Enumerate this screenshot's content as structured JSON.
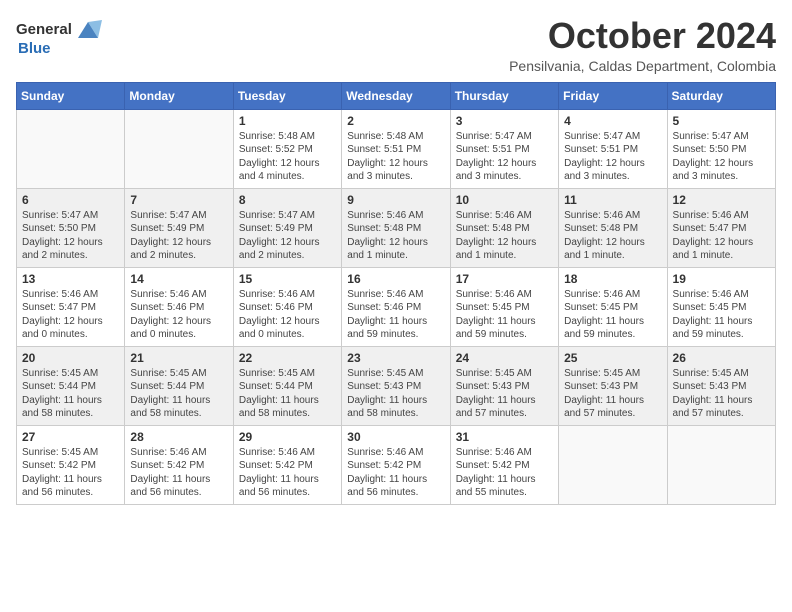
{
  "header": {
    "logo_line1": "General",
    "logo_line2": "Blue",
    "month": "October 2024",
    "location": "Pensilvania, Caldas Department, Colombia"
  },
  "days_of_week": [
    "Sunday",
    "Monday",
    "Tuesday",
    "Wednesday",
    "Thursday",
    "Friday",
    "Saturday"
  ],
  "weeks": [
    [
      {
        "day": "",
        "info": ""
      },
      {
        "day": "",
        "info": ""
      },
      {
        "day": "1",
        "info": "Sunrise: 5:48 AM\nSunset: 5:52 PM\nDaylight: 12 hours and 4 minutes."
      },
      {
        "day": "2",
        "info": "Sunrise: 5:48 AM\nSunset: 5:51 PM\nDaylight: 12 hours and 3 minutes."
      },
      {
        "day": "3",
        "info": "Sunrise: 5:47 AM\nSunset: 5:51 PM\nDaylight: 12 hours and 3 minutes."
      },
      {
        "day": "4",
        "info": "Sunrise: 5:47 AM\nSunset: 5:51 PM\nDaylight: 12 hours and 3 minutes."
      },
      {
        "day": "5",
        "info": "Sunrise: 5:47 AM\nSunset: 5:50 PM\nDaylight: 12 hours and 3 minutes."
      }
    ],
    [
      {
        "day": "6",
        "info": "Sunrise: 5:47 AM\nSunset: 5:50 PM\nDaylight: 12 hours and 2 minutes."
      },
      {
        "day": "7",
        "info": "Sunrise: 5:47 AM\nSunset: 5:49 PM\nDaylight: 12 hours and 2 minutes."
      },
      {
        "day": "8",
        "info": "Sunrise: 5:47 AM\nSunset: 5:49 PM\nDaylight: 12 hours and 2 minutes."
      },
      {
        "day": "9",
        "info": "Sunrise: 5:46 AM\nSunset: 5:48 PM\nDaylight: 12 hours and 1 minute."
      },
      {
        "day": "10",
        "info": "Sunrise: 5:46 AM\nSunset: 5:48 PM\nDaylight: 12 hours and 1 minute."
      },
      {
        "day": "11",
        "info": "Sunrise: 5:46 AM\nSunset: 5:48 PM\nDaylight: 12 hours and 1 minute."
      },
      {
        "day": "12",
        "info": "Sunrise: 5:46 AM\nSunset: 5:47 PM\nDaylight: 12 hours and 1 minute."
      }
    ],
    [
      {
        "day": "13",
        "info": "Sunrise: 5:46 AM\nSunset: 5:47 PM\nDaylight: 12 hours and 0 minutes."
      },
      {
        "day": "14",
        "info": "Sunrise: 5:46 AM\nSunset: 5:46 PM\nDaylight: 12 hours and 0 minutes."
      },
      {
        "day": "15",
        "info": "Sunrise: 5:46 AM\nSunset: 5:46 PM\nDaylight: 12 hours and 0 minutes."
      },
      {
        "day": "16",
        "info": "Sunrise: 5:46 AM\nSunset: 5:46 PM\nDaylight: 11 hours and 59 minutes."
      },
      {
        "day": "17",
        "info": "Sunrise: 5:46 AM\nSunset: 5:45 PM\nDaylight: 11 hours and 59 minutes."
      },
      {
        "day": "18",
        "info": "Sunrise: 5:46 AM\nSunset: 5:45 PM\nDaylight: 11 hours and 59 minutes."
      },
      {
        "day": "19",
        "info": "Sunrise: 5:46 AM\nSunset: 5:45 PM\nDaylight: 11 hours and 59 minutes."
      }
    ],
    [
      {
        "day": "20",
        "info": "Sunrise: 5:45 AM\nSunset: 5:44 PM\nDaylight: 11 hours and 58 minutes."
      },
      {
        "day": "21",
        "info": "Sunrise: 5:45 AM\nSunset: 5:44 PM\nDaylight: 11 hours and 58 minutes."
      },
      {
        "day": "22",
        "info": "Sunrise: 5:45 AM\nSunset: 5:44 PM\nDaylight: 11 hours and 58 minutes."
      },
      {
        "day": "23",
        "info": "Sunrise: 5:45 AM\nSunset: 5:43 PM\nDaylight: 11 hours and 58 minutes."
      },
      {
        "day": "24",
        "info": "Sunrise: 5:45 AM\nSunset: 5:43 PM\nDaylight: 11 hours and 57 minutes."
      },
      {
        "day": "25",
        "info": "Sunrise: 5:45 AM\nSunset: 5:43 PM\nDaylight: 11 hours and 57 minutes."
      },
      {
        "day": "26",
        "info": "Sunrise: 5:45 AM\nSunset: 5:43 PM\nDaylight: 11 hours and 57 minutes."
      }
    ],
    [
      {
        "day": "27",
        "info": "Sunrise: 5:45 AM\nSunset: 5:42 PM\nDaylight: 11 hours and 56 minutes."
      },
      {
        "day": "28",
        "info": "Sunrise: 5:46 AM\nSunset: 5:42 PM\nDaylight: 11 hours and 56 minutes."
      },
      {
        "day": "29",
        "info": "Sunrise: 5:46 AM\nSunset: 5:42 PM\nDaylight: 11 hours and 56 minutes."
      },
      {
        "day": "30",
        "info": "Sunrise: 5:46 AM\nSunset: 5:42 PM\nDaylight: 11 hours and 56 minutes."
      },
      {
        "day": "31",
        "info": "Sunrise: 5:46 AM\nSunset: 5:42 PM\nDaylight: 11 hours and 55 minutes."
      },
      {
        "day": "",
        "info": ""
      },
      {
        "day": "",
        "info": ""
      }
    ]
  ]
}
